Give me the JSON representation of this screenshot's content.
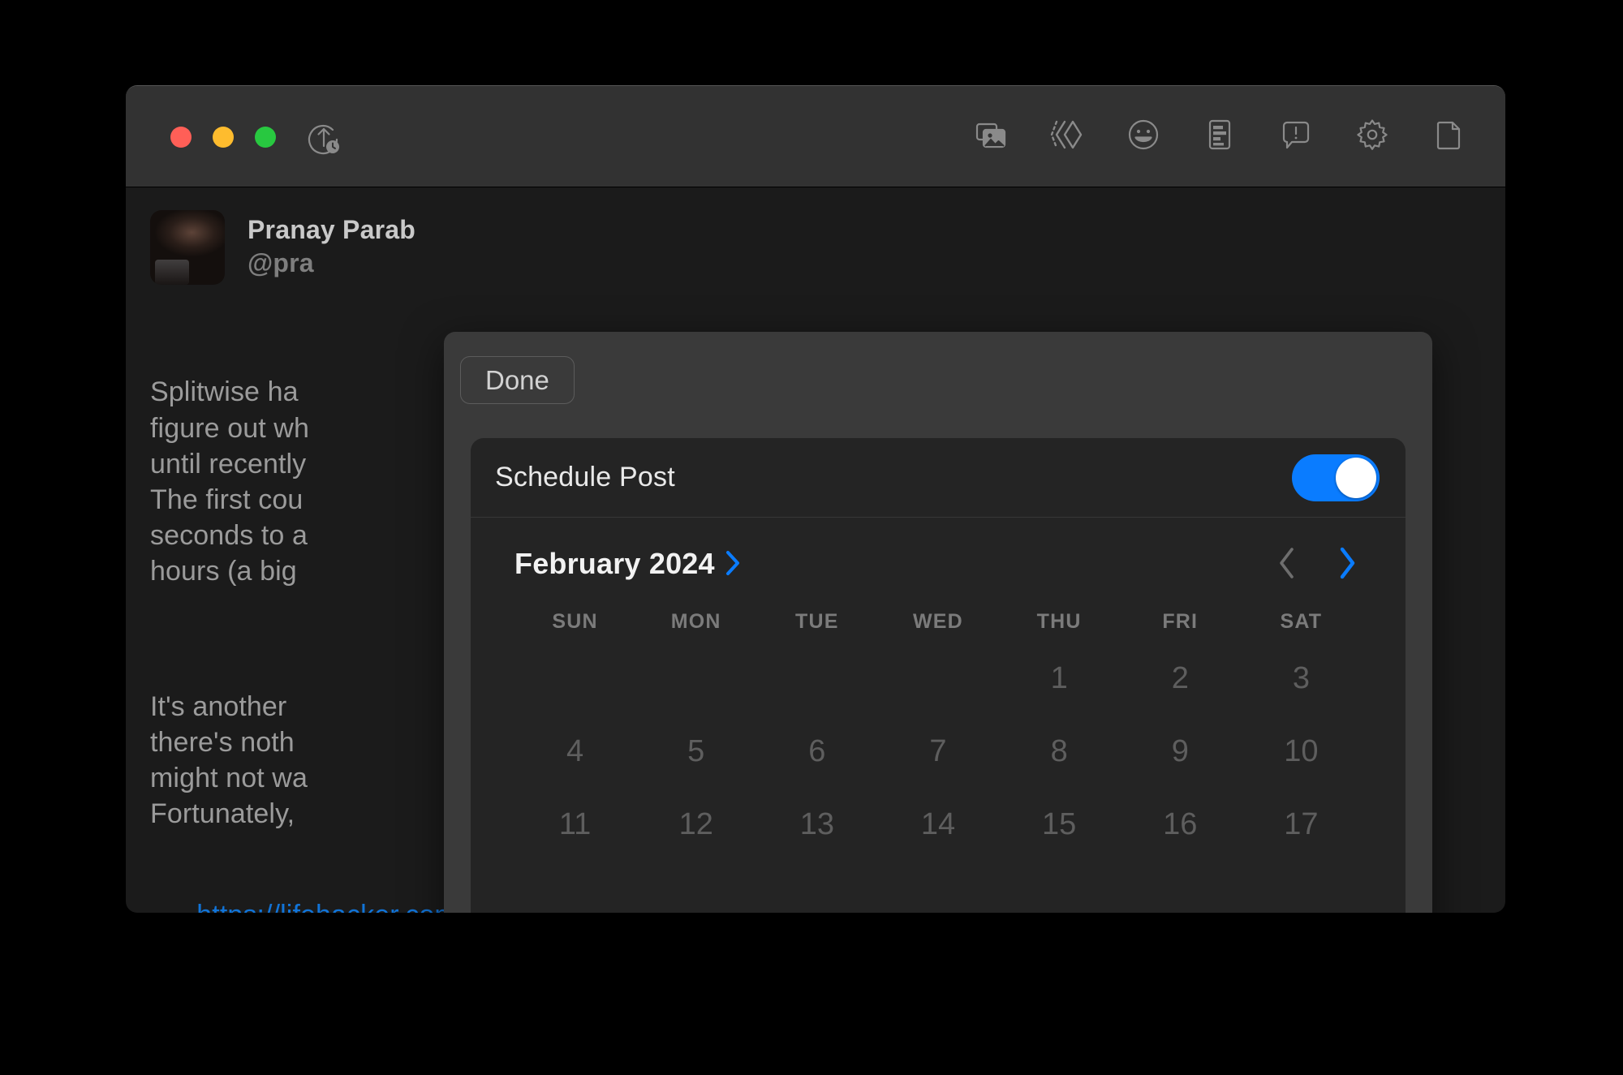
{
  "window": {
    "traffic_lights": [
      {
        "name": "close",
        "color": "#ff5f57"
      },
      {
        "name": "minimize",
        "color": "#febc2e"
      },
      {
        "name": "maximize",
        "color": "#28c840"
      }
    ],
    "toolbar": {
      "schedule_icon": "upload-clock-icon",
      "right_icons": [
        "image-icon",
        "chevrons-diamond-icon",
        "emoji-icon",
        "text-align-icon",
        "alert-comment-icon",
        "gear-icon",
        "file-icon"
      ]
    }
  },
  "post": {
    "author_display_name": "Pranay Parab",
    "author_handle": "@pra",
    "paragraph_1": "Splitwise ha                                    easy to\nfigure out wh                                   amazing\nuntil recently                                 ss useful:\nThe first cou                                 vait for 10\nseconds to a                                 ore for 24\nhours (a big",
    "paragraph_2": "It's another                                  . Of course,\nthere's noth                                 es, but you\nmight not wa                                        .\nFortunately,                                      free.",
    "link": "https://lifehacker.com/tech/best-free-splitwise-alternatives"
  },
  "schedule_sheet": {
    "done_label": "Done",
    "schedule_post_label": "Schedule Post",
    "toggle_on": true,
    "accent_color": "#0a7cff",
    "calendar": {
      "month_label": "February 2024",
      "month_expand_icon": "chevron-right-icon",
      "prev_icon": "chevron-left-icon",
      "next_icon": "chevron-right-icon",
      "prev_enabled": false,
      "next_enabled": true,
      "weekdays": [
        "SUN",
        "MON",
        "TUE",
        "WED",
        "THU",
        "FRI",
        "SAT"
      ],
      "leading_blanks": 4,
      "days": [
        1,
        2,
        3,
        4,
        5,
        6,
        7,
        8,
        9,
        10,
        11,
        12,
        13,
        14,
        15,
        16,
        17
      ]
    }
  }
}
